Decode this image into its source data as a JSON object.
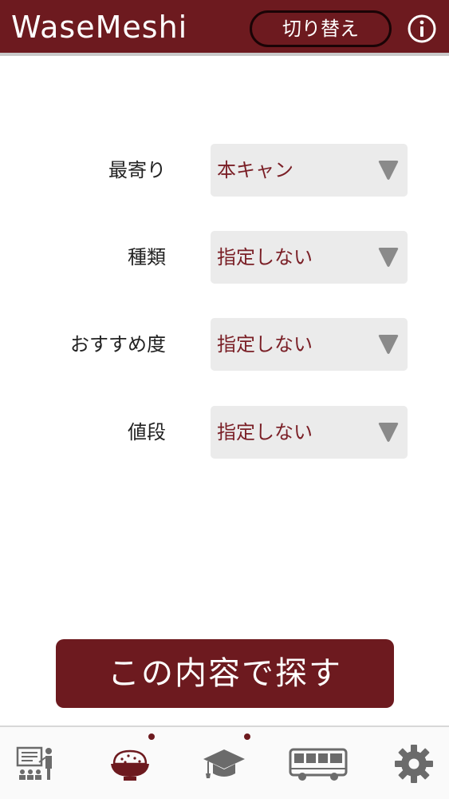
{
  "header": {
    "title": "WaseMeshi",
    "switch_label": "切り替え",
    "info_icon": "info-icon"
  },
  "form": {
    "rows": [
      {
        "label": "最寄り",
        "value": "本キャン"
      },
      {
        "label": "種類",
        "value": "指定しない"
      },
      {
        "label": "おすすめ度",
        "value": "指定しない"
      },
      {
        "label": "値段",
        "value": "指定しない"
      }
    ]
  },
  "search_button": {
    "label": "この内容で探す"
  },
  "bottom_nav": {
    "items": [
      {
        "icon": "presentation-icon",
        "badge": false
      },
      {
        "icon": "rice-bowl-icon",
        "badge": true
      },
      {
        "icon": "graduation-cap-icon",
        "badge": true
      },
      {
        "icon": "bus-icon",
        "badge": false
      },
      {
        "icon": "gear-icon",
        "badge": false
      }
    ]
  },
  "colors": {
    "primary": "#6d1a1f",
    "select_bg": "#ebebeb",
    "select_text": "#7a1f26",
    "arrow": "#8a8a8a",
    "icon_gray": "#6b6b6b"
  }
}
